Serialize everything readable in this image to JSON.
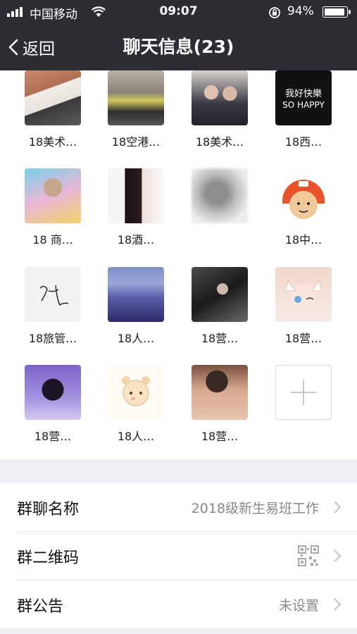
{
  "status_bar": {
    "carrier": "中国移动",
    "time": "09:07",
    "battery": "94%"
  },
  "nav": {
    "back_label": "返回",
    "title": "聊天信息(23)"
  },
  "members": [
    {
      "name": "18美术…",
      "avatar": "photo"
    },
    {
      "name": "18空港…",
      "avatar": "photo"
    },
    {
      "name": "18美术…",
      "avatar": "photo"
    },
    {
      "name": "18西…",
      "avatar": "text",
      "avatar_text_1": "我好快樂",
      "avatar_text_2": "SO HAPPY"
    },
    {
      "name": "18 商…",
      "avatar": "photo"
    },
    {
      "name": "18酒…",
      "avatar": "photo"
    },
    {
      "name": "",
      "avatar": "photo"
    },
    {
      "name": "18中…",
      "avatar": "photo"
    },
    {
      "name": "18旅管…",
      "avatar": "photo"
    },
    {
      "name": "18人…",
      "avatar": "photo"
    },
    {
      "name": "18营…",
      "avatar": "photo"
    },
    {
      "name": "18营…",
      "avatar": "photo"
    },
    {
      "name": "18营…",
      "avatar": "photo"
    },
    {
      "name": "18人…",
      "avatar": "photo"
    },
    {
      "name": "18营…",
      "avatar": "photo"
    }
  ],
  "settings": {
    "group_name": {
      "label": "群聊名称",
      "value": "2018级新生易班工作"
    },
    "group_qr": {
      "label": "群二维码"
    },
    "announcement": {
      "label": "群公告",
      "value": "未设置"
    }
  },
  "colors": {
    "nav_bg": "#2e2d33",
    "page_bg": "#efeff4"
  }
}
